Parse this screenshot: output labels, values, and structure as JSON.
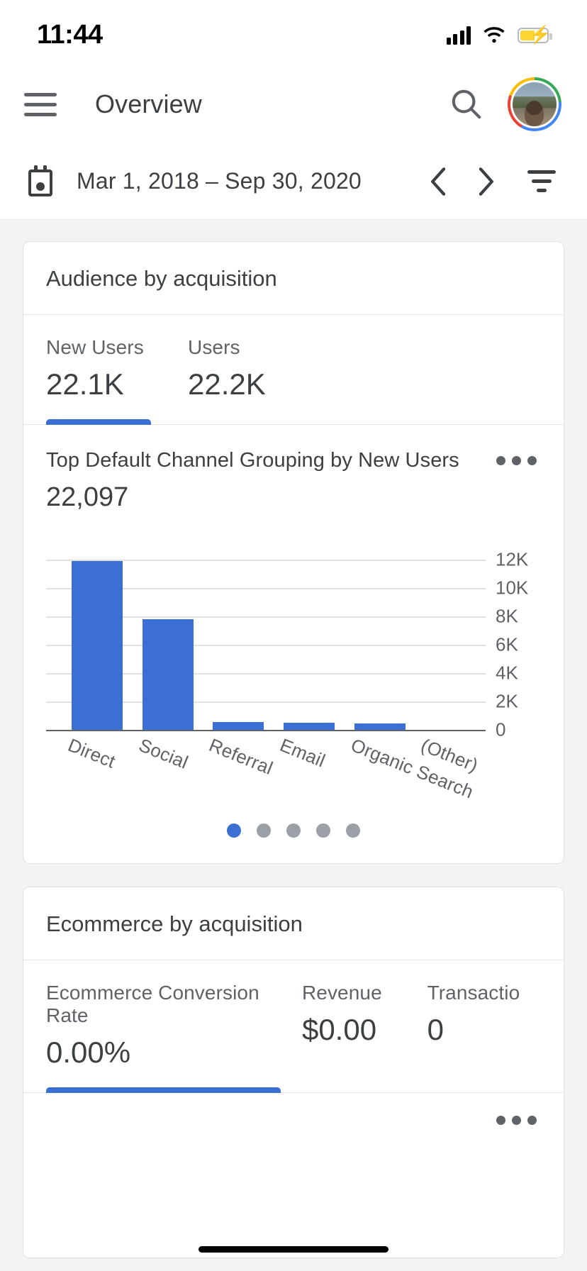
{
  "status_bar": {
    "time": "11:44",
    "icons": {
      "cellular": "signal-bars-icon",
      "wifi": "wifi-icon",
      "battery": "battery-charging-icon"
    }
  },
  "app_bar": {
    "menu_icon": "hamburger-menu-icon",
    "title": "Overview",
    "search_icon": "search-icon",
    "avatar": "user-avatar"
  },
  "date_bar": {
    "calendar_icon": "calendar-icon",
    "range": "Mar 1, 2018 – Sep 30, 2020",
    "prev_icon": "chevron-left-icon",
    "next_icon": "chevron-right-icon",
    "filter_icon": "filter-icon"
  },
  "colors": {
    "accent": "#3b6fd4",
    "bar": "#3b6fd4",
    "text_primary": "#3c4043",
    "text_secondary": "#5f6368",
    "page_bg": "#f1f3f4",
    "card_bg": "#ffffff",
    "grid": "#e0e2e4",
    "dot_inactive": "#9aa0a6"
  },
  "cards": [
    {
      "title": "Audience by acquisition",
      "metrics": [
        {
          "label": "New Users",
          "value": "22.1K",
          "active": true
        },
        {
          "label": "Users",
          "value": "22.2K",
          "active": false
        }
      ],
      "chart_title": "Top Default Channel Grouping by New Users",
      "chart_total": "22,097",
      "menu_icon": "more-options-icon",
      "pagination": {
        "count": 5,
        "active_index": 0
      }
    },
    {
      "title": "Ecommerce by acquisition",
      "metrics": [
        {
          "label": "Ecommerce Conversion Rate",
          "value": "0.00%",
          "active": true
        },
        {
          "label": "Revenue",
          "value": "$0.00",
          "active": false
        },
        {
          "label": "Transactio",
          "value": "0",
          "active": false
        }
      ],
      "menu_icon": "more-options-icon"
    }
  ],
  "chart_data": {
    "type": "bar",
    "title": "Top Default Channel Grouping by New Users",
    "total": 22097,
    "categories": [
      "Direct",
      "Social",
      "Referral",
      "Email",
      "Organic Search",
      "(Other)"
    ],
    "values": [
      11900,
      7800,
      560,
      510,
      460,
      0
    ],
    "series": [
      {
        "name": "New Users",
        "values": [
          11900,
          7800,
          560,
          510,
          460,
          0
        ]
      }
    ],
    "xlabel": "",
    "ylabel": "",
    "ylim": [
      0,
      13000
    ],
    "yticks": [
      0,
      2000,
      4000,
      6000,
      8000,
      10000,
      12000
    ],
    "ytick_labels": [
      "0",
      "2K",
      "4K",
      "6K",
      "8K",
      "10K",
      "12K"
    ],
    "y_axis_position": "right",
    "grid": true,
    "legend": false,
    "bar_color": "#3b6fd4"
  }
}
